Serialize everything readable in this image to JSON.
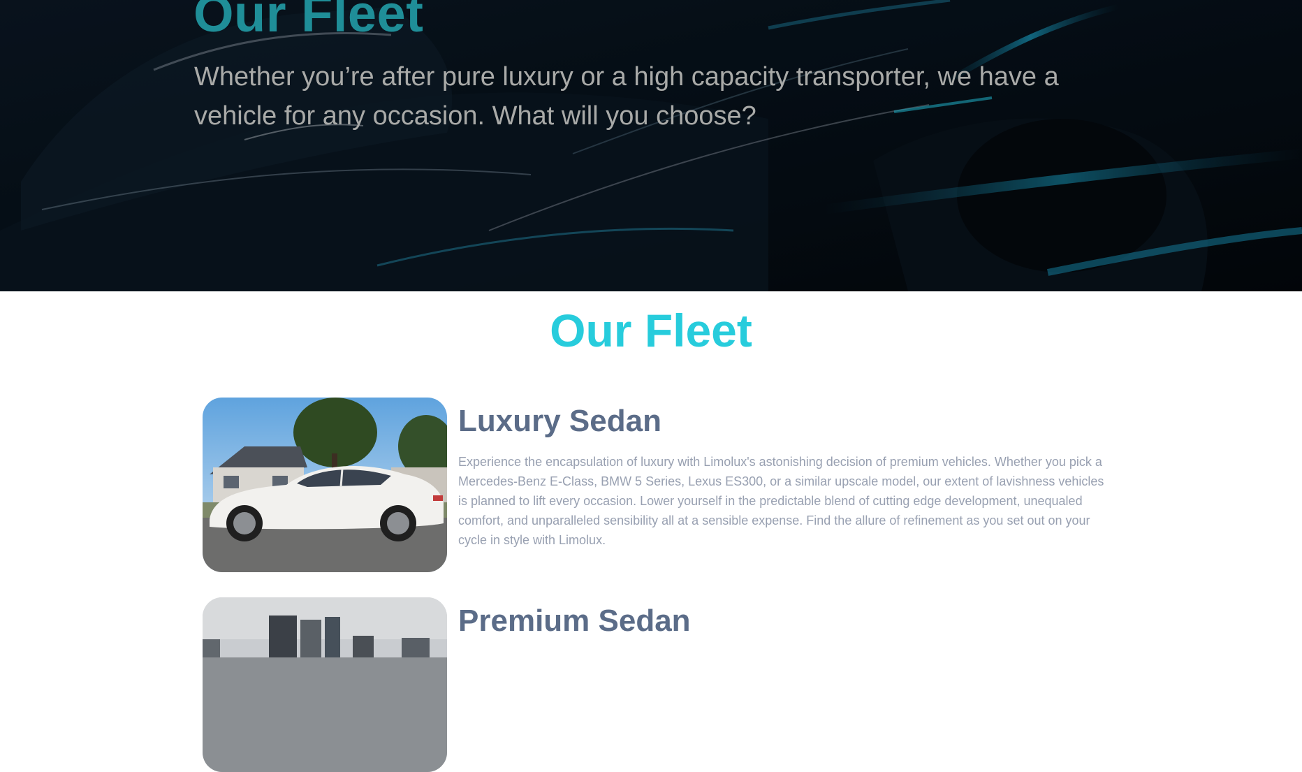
{
  "hero": {
    "title": "Our Fleet",
    "subtitle": "Whether you’re after pure luxury or a high capacity transporter, we have a vehicle for any occasion. What will you choose?"
  },
  "fleet": {
    "title": "Our Fleet",
    "cards": [
      {
        "title": "Luxury Sedan",
        "description": "Experience the encapsulation of luxury with Limolux's astonishing decision of premium vehicles. Whether you pick a Mercedes-Benz E-Class, BMW 5 Series, Lexus ES300, or a similar upscale model, our extent of lavishness vehicles is planned to lift every occasion. Lower yourself in the predictable blend of cutting edge development, unequaled comfort, and unparalleled sensibility all at a sensible expense. Find the allure of refinement as you set out on your cycle in style with Limolux."
      },
      {
        "title": "Premium Sedan",
        "description": ""
      }
    ]
  },
  "colors": {
    "accent": "#27ccdc",
    "hero_title": "#1f8e98",
    "card_title": "#5b6c88",
    "body_text": "#98a0b1"
  }
}
